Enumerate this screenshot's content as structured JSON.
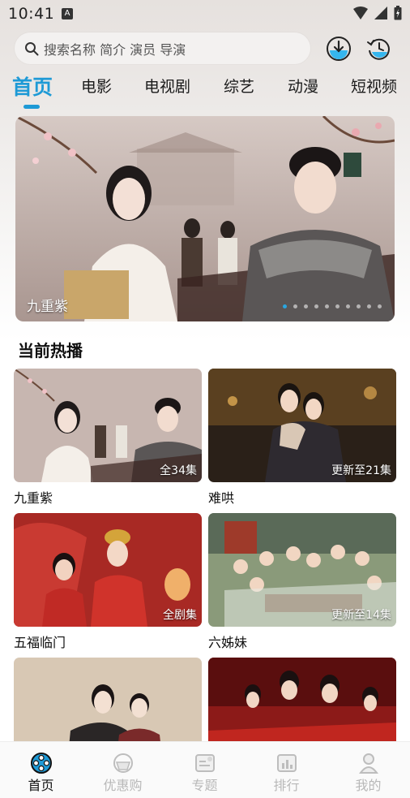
{
  "status": {
    "time": "10:41",
    "notif": "A"
  },
  "search": {
    "placeholder": "搜索名称 简介 演员 导演"
  },
  "header": {
    "icons": [
      "download-icon",
      "history-icon"
    ]
  },
  "tabs": [
    {
      "label": "首页",
      "active": true
    },
    {
      "label": "电影"
    },
    {
      "label": "电视剧"
    },
    {
      "label": "综艺"
    },
    {
      "label": "动漫"
    },
    {
      "label": "短视频"
    }
  ],
  "banner": {
    "title": "九重紫",
    "dot_count": 10,
    "active_dot": 0
  },
  "section": {
    "title": "当前热播"
  },
  "cards": [
    {
      "title": "九重紫",
      "badge": "全34集"
    },
    {
      "title": "难哄",
      "badge": "更新至21集"
    },
    {
      "title": "五福临门",
      "badge": "全剧集"
    },
    {
      "title": "六姊妹",
      "badge": "更新至14集"
    },
    {
      "title": "",
      "badge": ""
    },
    {
      "title": "",
      "badge": ""
    }
  ],
  "nav": [
    {
      "label": "首页",
      "icon": "home-film-icon",
      "active": true
    },
    {
      "label": "优惠购",
      "icon": "coupon-icon"
    },
    {
      "label": "专题",
      "icon": "topic-icon"
    },
    {
      "label": "排行",
      "icon": "ranking-icon"
    },
    {
      "label": "我的",
      "icon": "profile-icon"
    }
  ],
  "colors": {
    "accent": "#1e9ad6",
    "nav_inactive": "#b8b8b8"
  }
}
